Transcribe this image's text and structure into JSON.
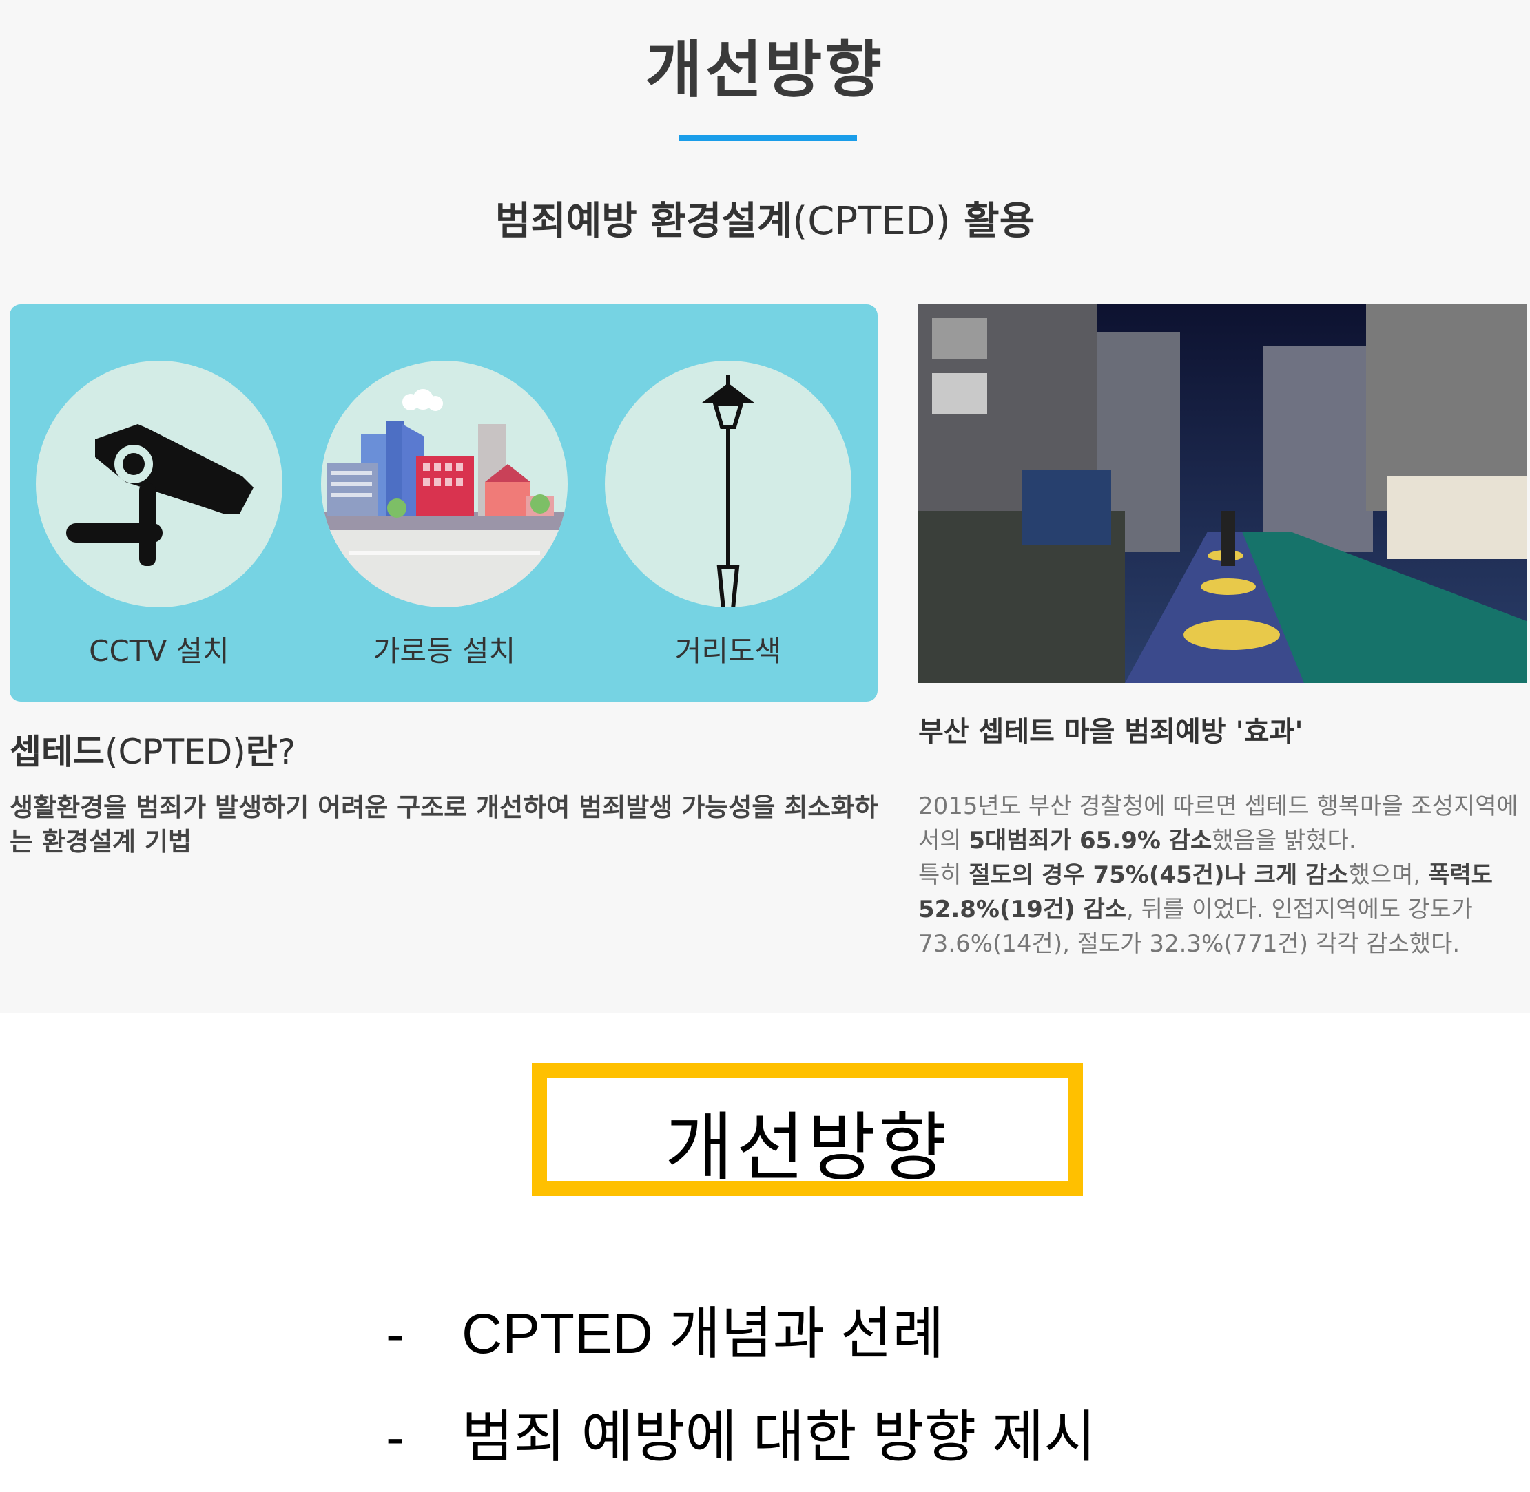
{
  "header": {
    "title": "개선방향",
    "subtitle_bold": "범죄예방 환경설계",
    "subtitle_paren": "(CPTED)",
    "subtitle_end": " 활용"
  },
  "icons": [
    {
      "name": "cctv-icon",
      "label": "CCTV 설치"
    },
    {
      "name": "city-buildings-icon",
      "label": "가로등 설치"
    },
    {
      "name": "street-lamp-icon",
      "label": "거리도색"
    }
  ],
  "cpted": {
    "heading_bold": "셉테드",
    "heading_paren": "(CPTED)",
    "heading_bold2": "란",
    "heading_q": "?",
    "description": "생활환경을 범죄가 발생하기 어려운 구조로 개선하여 범죄발생 가능성을 최소화하는 환경설계 기법"
  },
  "busan": {
    "heading": "부산 셉테트 마을 범죄예방 '효과'",
    "p1": "2015년도 부산 경찰청에 따르면 셉테드 행복마을 조성지역에서의 ",
    "p2_bold": "5대범죄가 65.9% 감소",
    "p3": "했음을 밝혔다.",
    "p4": "특히 ",
    "p5_bold": "절도의 경우 75%(45건)나 크게 감소",
    "p6": "했으며, ",
    "p7_bold": "폭력도 52.8%(19건) 감소",
    "p8": ", 뒤를 이었다. 인접지역에도 강도가 73.6%(14건), 절도가 32.3%(771건) 각각 감소했다."
  },
  "box": {
    "title": "개선방향"
  },
  "bullets": [
    {
      "dash": "-",
      "text": "CPTED 개념과 선례"
    },
    {
      "dash": "-",
      "text": "범죄 예방에 대한 방향 제시"
    }
  ],
  "colors": {
    "accent_blue": "#1a9de9",
    "panel_cyan": "#76d3e3",
    "circle_bg": "#d3ece6",
    "box_border": "#ffc000"
  }
}
